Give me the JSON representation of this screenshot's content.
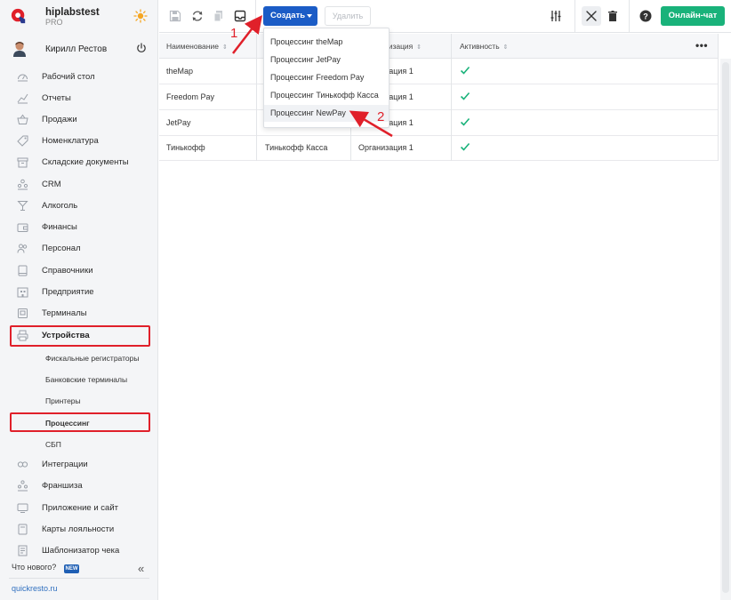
{
  "brand": {
    "name": "hiplabstest",
    "plan": "PRO"
  },
  "user": {
    "name": "Кирилл Рестов"
  },
  "sidebar": {
    "items": [
      {
        "label": "Рабочий стол",
        "icon": "dashboard-icon"
      },
      {
        "label": "Отчеты",
        "icon": "reports-icon"
      },
      {
        "label": "Продажи",
        "icon": "sales-basket-icon"
      },
      {
        "label": "Номенклатура",
        "icon": "nomenclature-tag-icon"
      },
      {
        "label": "Складские документы",
        "icon": "warehouse-icon"
      },
      {
        "label": "CRM",
        "icon": "crm-people-icon"
      },
      {
        "label": "Алкоголь",
        "icon": "alcohol-glass-icon"
      },
      {
        "label": "Финансы",
        "icon": "finance-wallet-icon"
      },
      {
        "label": "Персонал",
        "icon": "staff-icon"
      },
      {
        "label": "Справочники",
        "icon": "reference-book-icon"
      },
      {
        "label": "Предприятие",
        "icon": "enterprise-icon"
      },
      {
        "label": "Терминалы",
        "icon": "terminal-icon"
      },
      {
        "label": "Устройства",
        "icon": "devices-printer-icon"
      }
    ],
    "sub_items": [
      {
        "label": "Фискальные регистраторы"
      },
      {
        "label": "Банковские терминалы"
      },
      {
        "label": "Принтеры"
      },
      {
        "label": "Процессинг"
      },
      {
        "label": "СБП"
      }
    ],
    "bottom_items": [
      {
        "label": "Интеграции",
        "icon": "integrations-icon"
      },
      {
        "label": "Франшиза",
        "icon": "franchise-icon"
      },
      {
        "label": "Приложение и сайт",
        "icon": "app-site-icon"
      },
      {
        "label": "Карты лояльности",
        "icon": "loyalty-card-icon"
      },
      {
        "label": "Шаблонизатор чека",
        "icon": "receipt-template-icon"
      }
    ],
    "whats_new": "Что нового?",
    "new_badge": "NEW",
    "collapse": "«",
    "site_link": "quickresto.ru"
  },
  "toolbar": {
    "create_label": "Создать",
    "delete_label": "Удалить",
    "chat_label": "Онлайн-чат"
  },
  "dropdown": {
    "items": [
      "Процессинг theMap",
      "Процессинг JetPay",
      "Процессинг Freedom Pay",
      "Процессинг Тинькофф Касса",
      "Процессинг NewPay"
    ]
  },
  "table": {
    "columns": [
      "Наименование",
      "",
      "Организация",
      "Активность"
    ],
    "col_header_visible_partial": "низация",
    "rows": [
      {
        "name": "theMap",
        "type": "",
        "org": "Организация 1",
        "active": true
      },
      {
        "name": "Freedom Pay",
        "type": "",
        "org": "Организация 1",
        "active": true
      },
      {
        "name": "JetPay",
        "type": "",
        "org": "Организация 1",
        "active": true
      },
      {
        "name": "Тинькофф",
        "type": "Тинькофф Касса",
        "org": "Организация 1",
        "active": true
      }
    ]
  },
  "annotations": {
    "step1": "1",
    "step2": "2"
  },
  "colors": {
    "primary": "#1b5cc6",
    "chat": "#19b27a",
    "highlight": "#e0202a",
    "check": "#19b27a"
  }
}
